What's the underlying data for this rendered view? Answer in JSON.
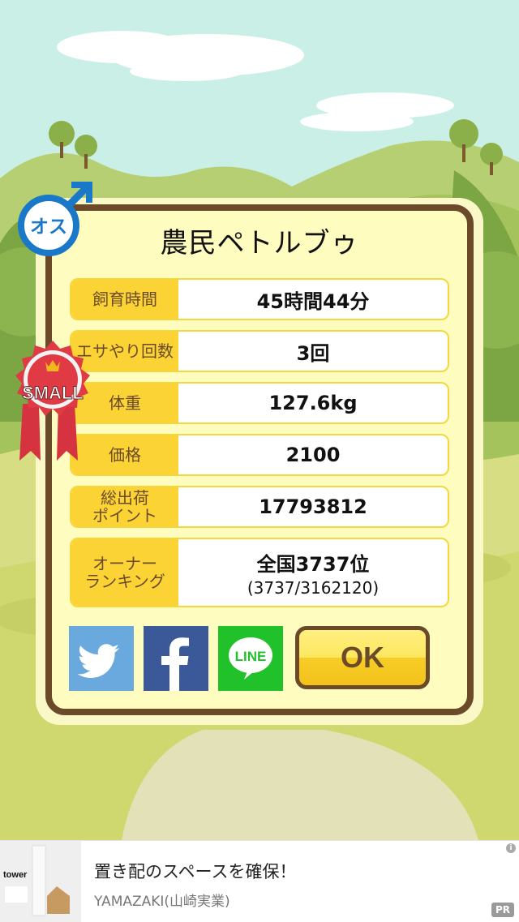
{
  "pet": {
    "name": "農民ペトルブゥ"
  },
  "gender_badge": {
    "label": "オス"
  },
  "size_badge": {
    "label": "SMALL"
  },
  "stats": [
    {
      "label": "飼育時間",
      "value": "45時間44分"
    },
    {
      "label": "エサやり回数",
      "value": "3回"
    },
    {
      "label": "体重",
      "value": "127.6kg"
    },
    {
      "label": "価格",
      "value": "2100"
    },
    {
      "label": "総出荷\nポイント",
      "value": "17793812"
    },
    {
      "label": "オーナー\nランキング",
      "value": "全国3737位",
      "sub": "(3737/3162120)"
    }
  ],
  "share": {
    "twitter": "twitter",
    "facebook": "facebook",
    "line_label": "LINE"
  },
  "ok_button": {
    "label": "OK"
  },
  "ad": {
    "title": "置き配のスペースを確保！",
    "advertiser": "YAMAZAKI(山崎実業)",
    "image_text": "tower",
    "pr_label": "PR",
    "info_icon": "i"
  },
  "colors": {
    "sky": "#c9efe6",
    "card_border": "#6b4a2a",
    "label_bg": "#fbd335",
    "twitter": "#6aa9dd",
    "facebook": "#3b5998",
    "line": "#21c12c",
    "gender": "#1a78c8",
    "ribbon": "#e03a45"
  }
}
